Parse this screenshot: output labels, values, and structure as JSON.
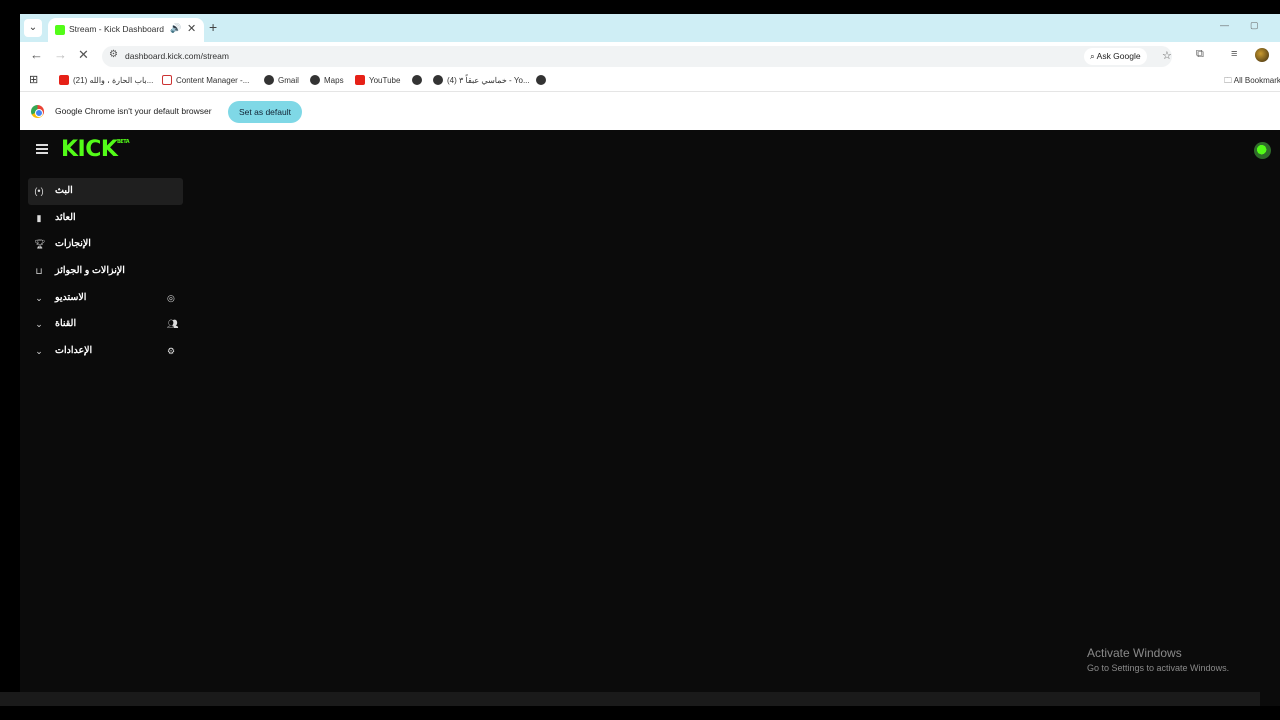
{
  "browser": {
    "tab": {
      "title": "Stream - Kick Dashboard",
      "audio_icon": "speaker-icon",
      "close_icon": "close-icon"
    },
    "new_tab_label": "+",
    "url": "dashboard.kick.com/stream",
    "ask_google": "Ask Google",
    "bookmarks": [
      {
        "label": "(21) باب الحارة ، والله...",
        "icon": "youtube-icon"
      },
      {
        "label": "Content Manager -...",
        "icon": "content-manager-icon"
      },
      {
        "label": "Gmail",
        "icon": "globe-icon"
      },
      {
        "label": "Maps",
        "icon": "globe-icon"
      },
      {
        "label": "YouTube",
        "icon": "youtube-icon"
      },
      {
        "label": "",
        "icon": "globe-icon"
      },
      {
        "label": "(4) خماسي عبقاً ٣ - Yo...",
        "icon": "globe-icon"
      },
      {
        "label": "",
        "icon": "globe-icon"
      }
    ],
    "all_bookmarks": "All Bookmarks",
    "infobar_text": "Google Chrome isn't your default browser",
    "set_default": "Set as default"
  },
  "app": {
    "brand": "KICK",
    "brand_badge": "BETA",
    "nav": [
      {
        "label": "البث",
        "icon": "stream-icon",
        "active": true,
        "expandable": false
      },
      {
        "label": "العائد",
        "icon": "revenue-icon",
        "active": false,
        "expandable": false
      },
      {
        "label": "الإنجازات",
        "icon": "trophy-icon",
        "active": false,
        "expandable": false
      },
      {
        "label": "الإنزالات و الجوائز",
        "icon": "drops-icon",
        "active": false,
        "expandable": false
      },
      {
        "label": "الاستديو",
        "icon": "studio-icon",
        "active": false,
        "expandable": true
      },
      {
        "label": "القناة",
        "icon": "channel-icon",
        "active": false,
        "expandable": true
      },
      {
        "label": "الإعدادات",
        "icon": "gear-icon",
        "active": false,
        "expandable": true
      }
    ]
  },
  "windows": {
    "activate_title": "Activate Windows",
    "activate_subtitle": "Go to Settings to activate Windows."
  },
  "colors": {
    "kick_green": "#53fc18",
    "background": "#0b0b0b",
    "tabstrip": "#cfeef5"
  }
}
